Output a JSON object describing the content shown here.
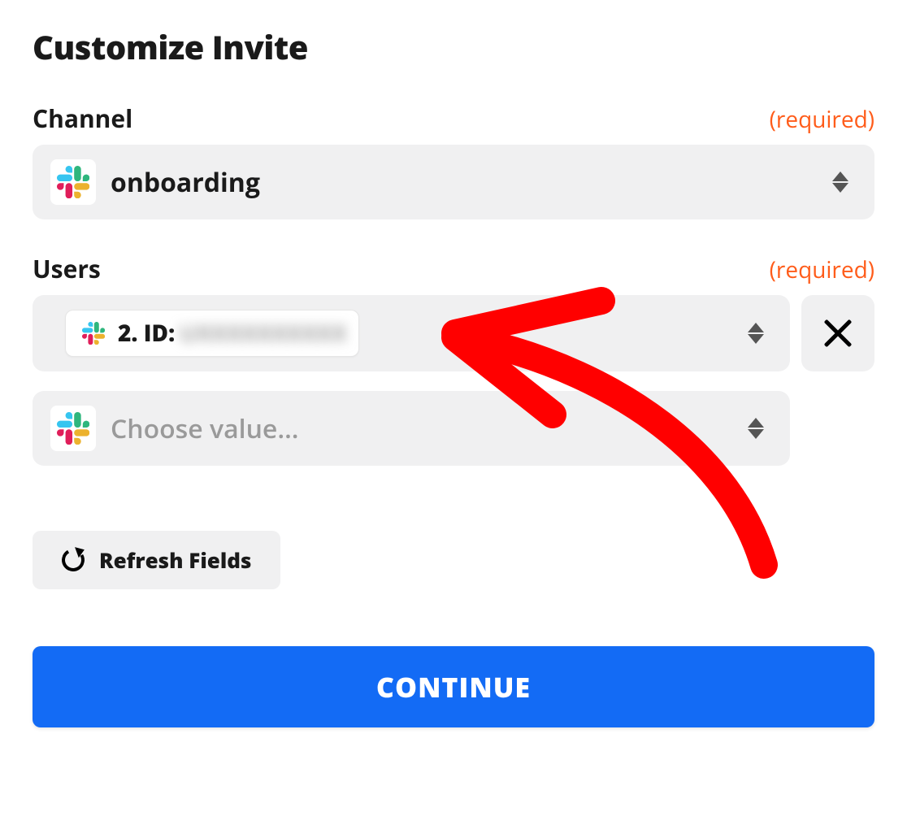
{
  "title": "Customize Invite",
  "required_label": "(required)",
  "refresh_label": "Refresh Fields",
  "continue_label": "CONTINUE",
  "channel": {
    "label": "Channel",
    "value": "onboarding"
  },
  "users": {
    "label": "Users",
    "selected": {
      "prefix": "2. ID:",
      "value_obscured": "UXXXXXXXXXX"
    },
    "placeholder": "Choose value…"
  },
  "icons": {
    "app": "slack"
  },
  "colors": {
    "accent": "#136bf5",
    "required": "#ff5c1a",
    "annotation": "#ff0000"
  }
}
